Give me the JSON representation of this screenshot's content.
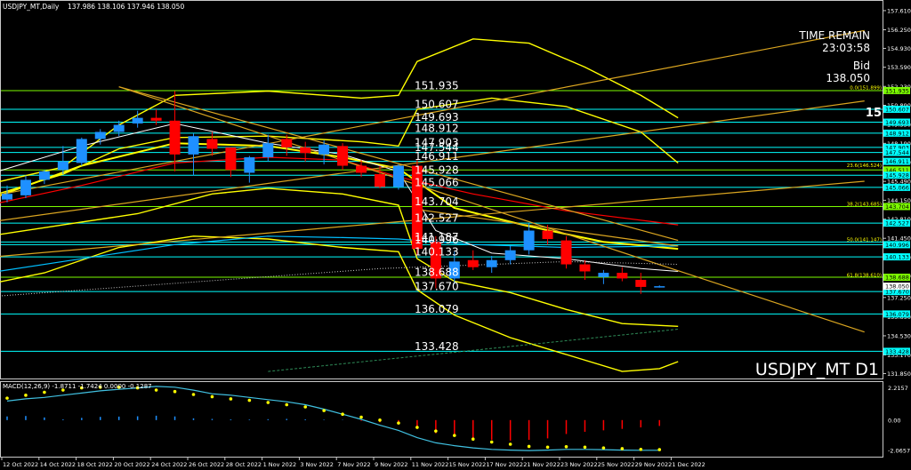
{
  "header": {
    "symbol_timeframe": "USDJPY_MT,Daily",
    "ohlc": "137.986 138.106 137.946 138.050"
  },
  "info_panel": {
    "time_remain_label": "TIME REMAIN",
    "time_remain_value": "23:03:58",
    "bid_label": "Bid",
    "bid_value": "138.050",
    "edge_number": "15"
  },
  "watermark": "USDJPY_MT D1",
  "macd_label": "MACD(12,26,9) -1.8711 -1.7424 0.0000 -0.1287",
  "colors": {
    "background": "#000000",
    "bull_candle": "#1e90ff",
    "bear_candle": "#ff0000",
    "level_line": "#00ffff",
    "green_level": "#7cfc00",
    "envelope": "#ffff00",
    "channel": "#daa520",
    "ma_red": "#ff0000",
    "ma_white": "#ffffff",
    "ma_blue": "#00bfff"
  },
  "price_axis": {
    "ticks": [
      "157.610",
      "156.250",
      "154.930",
      "153.590",
      "152.230",
      "150.890",
      "149.550",
      "148.190",
      "146.850",
      "145.490",
      "144.150",
      "142.810",
      "141.450",
      "140.110",
      "138.770",
      "137.250",
      "135.890",
      "134.530",
      "133.170",
      "131.850"
    ],
    "min": 131.5,
    "max": 158.3
  },
  "macd_axis": {
    "ticks": [
      "2.2157",
      "0.00",
      "-2.0657"
    ],
    "min": -2.5,
    "max": 2.6
  },
  "date_axis": [
    "12 Oct 2022",
    "14 Oct 2022",
    "18 Oct 2022",
    "20 Oct 2022",
    "24 Oct 2022",
    "26 Oct 2022",
    "28 Oct 2022",
    "1 Nov 2022",
    "3 Nov 2022",
    "7 Nov 2022",
    "9 Nov 2022",
    "11 Nov 2022",
    "15 Nov 2022",
    "17 Nov 2022",
    "21 Nov 2022",
    "23 Nov 2022",
    "25 Nov 2022",
    "29 Nov 2022",
    "1 Dec 2022"
  ],
  "levels": [
    {
      "value": 151.935,
      "label": "151.935",
      "badge": "151.935",
      "color": "#7cfc00"
    },
    {
      "value": 150.607,
      "label": "150.607",
      "badge": "150.607",
      "color": "#00ffff"
    },
    {
      "value": 149.693,
      "label": "149.693",
      "badge": "149.693",
      "color": "#00ffff"
    },
    {
      "value": 148.912,
      "label": "148.912",
      "badge": "148.912",
      "color": "#00ffff"
    },
    {
      "value": 147.903,
      "label": "147.903",
      "badge": "147.903",
      "color": "#00ffff"
    },
    {
      "value": 147.544,
      "label": "147.544",
      "badge": "147.544",
      "color": "#00ffff"
    },
    {
      "value": 146.911,
      "label": "146.911",
      "badge": "146.911",
      "color": "#00ffff"
    },
    {
      "value": 146.3,
      "label": "",
      "badge": "146.511",
      "color": "#7cfc00"
    },
    {
      "value": 145.928,
      "label": "145.928",
      "badge": "145.928",
      "color": "#00ffff"
    },
    {
      "value": 145.066,
      "label": "145.066",
      "badge": "145.066",
      "color": "#00ffff"
    },
    {
      "value": 143.704,
      "label": "143.704",
      "badge": "143.704",
      "color": "#7cfc00"
    },
    {
      "value": 142.527,
      "label": "142.527",
      "badge": "142.527",
      "color": "#00ffff"
    },
    {
      "value": 141.187,
      "label": "141.187",
      "badge": "",
      "color": "#00ffff"
    },
    {
      "value": 140.996,
      "label": "140.996",
      "badge": "140.996",
      "color": "#00ffff"
    },
    {
      "value": 140.133,
      "label": "140.133",
      "badge": "140.133",
      "color": "#00ffff"
    },
    {
      "value": 138.688,
      "label": "138.688",
      "badge": "138.688",
      "color": "#7cfc00"
    },
    {
      "value": 137.67,
      "label": "137.670",
      "badge": "137.670",
      "color": "#00ffff"
    },
    {
      "value": 136.079,
      "label": "136.079",
      "badge": "136.079",
      "color": "#00ffff"
    },
    {
      "value": 133.428,
      "label": "133.428",
      "badge": "133.428",
      "color": "#00ffff"
    }
  ],
  "fib_labels": [
    {
      "value": 151.935,
      "text": "0.0(151.899)"
    },
    {
      "value": 146.4,
      "text": "23.6(146.524)"
    },
    {
      "value": 143.685,
      "text": "38.2(143.685)"
    },
    {
      "value": 141.147,
      "text": "50.0(141.147)"
    },
    {
      "value": 138.61,
      "text": "61.8(138.610)"
    }
  ],
  "candles": [
    {
      "o": 144.2,
      "h": 145.2,
      "l": 144.0,
      "c": 144.6
    },
    {
      "o": 144.5,
      "h": 145.9,
      "l": 144.3,
      "c": 145.6
    },
    {
      "o": 145.6,
      "h": 146.3,
      "l": 145.3,
      "c": 146.2
    },
    {
      "o": 146.3,
      "h": 148.0,
      "l": 146.0,
      "c": 146.9
    },
    {
      "o": 146.8,
      "h": 148.6,
      "l": 146.6,
      "c": 148.5
    },
    {
      "o": 148.5,
      "h": 149.2,
      "l": 148.1,
      "c": 149.0
    },
    {
      "o": 149.0,
      "h": 149.8,
      "l": 148.7,
      "c": 149.5
    },
    {
      "o": 149.6,
      "h": 150.5,
      "l": 149.3,
      "c": 150.0
    },
    {
      "o": 150.0,
      "h": 150.6,
      "l": 149.5,
      "c": 149.8
    },
    {
      "o": 149.8,
      "h": 151.9,
      "l": 146.2,
      "c": 147.4
    },
    {
      "o": 147.4,
      "h": 148.9,
      "l": 145.9,
      "c": 148.7
    },
    {
      "o": 148.5,
      "h": 149.0,
      "l": 147.3,
      "c": 147.8
    },
    {
      "o": 147.9,
      "h": 147.9,
      "l": 145.8,
      "c": 146.3
    },
    {
      "o": 146.1,
      "h": 147.3,
      "l": 145.4,
      "c": 147.2
    },
    {
      "o": 147.2,
      "h": 148.8,
      "l": 146.9,
      "c": 148.2
    },
    {
      "o": 148.5,
      "h": 148.8,
      "l": 147.3,
      "c": 147.9
    },
    {
      "o": 147.9,
      "h": 148.3,
      "l": 146.9,
      "c": 147.5
    },
    {
      "o": 147.4,
      "h": 148.4,
      "l": 146.7,
      "c": 148.1
    },
    {
      "o": 148.0,
      "h": 148.2,
      "l": 146.3,
      "c": 146.6
    },
    {
      "o": 146.6,
      "h": 147.0,
      "l": 145.8,
      "c": 146.1
    },
    {
      "o": 146.0,
      "h": 146.6,
      "l": 145.0,
      "c": 145.1
    },
    {
      "o": 145.1,
      "h": 146.7,
      "l": 144.9,
      "c": 146.6
    },
    {
      "o": 146.6,
      "h": 147.0,
      "l": 140.3,
      "c": 140.7
    },
    {
      "o": 141.2,
      "h": 141.6,
      "l": 137.9,
      "c": 138.6
    },
    {
      "o": 138.6,
      "h": 140.5,
      "l": 138.2,
      "c": 139.8
    },
    {
      "o": 139.9,
      "h": 140.6,
      "l": 139.2,
      "c": 139.4
    },
    {
      "o": 139.4,
      "h": 140.2,
      "l": 139.0,
      "c": 139.9
    },
    {
      "o": 139.9,
      "h": 140.9,
      "l": 139.6,
      "c": 140.6
    },
    {
      "o": 140.6,
      "h": 142.5,
      "l": 140.3,
      "c": 142.0
    },
    {
      "o": 142.0,
      "h": 142.4,
      "l": 141.0,
      "c": 141.4
    },
    {
      "o": 141.3,
      "h": 141.6,
      "l": 139.3,
      "c": 139.6
    },
    {
      "o": 139.6,
      "h": 139.9,
      "l": 138.5,
      "c": 139.1
    },
    {
      "o": 138.7,
      "h": 139.2,
      "l": 138.2,
      "c": 139.0
    },
    {
      "o": 139.0,
      "h": 139.4,
      "l": 138.4,
      "c": 138.6
    },
    {
      "o": 138.5,
      "h": 139.0,
      "l": 137.5,
      "c": 138.0
    },
    {
      "o": 137.99,
      "h": 138.11,
      "l": 137.95,
      "c": 138.05
    }
  ],
  "macd_hist": [
    0.25,
    0.28,
    0.18,
    0.05,
    0.15,
    0.22,
    0.24,
    0.26,
    0.3,
    0.25,
    0.12,
    0.08,
    0.05,
    0.04,
    0.06,
    0.08,
    0.05,
    0.03,
    0.02,
    -0.05,
    -0.15,
    -0.3,
    -0.6,
    -0.9,
    -1.1,
    -1.25,
    -1.35,
    -1.4,
    -1.35,
    -1.25,
    -0.95,
    -0.8,
    -0.7,
    -0.6,
    -0.5,
    -0.4
  ],
  "macd_signal": [
    1.5,
    1.7,
    1.9,
    2.05,
    2.2,
    2.25,
    2.25,
    2.2,
    2.05,
    1.95,
    1.75,
    1.6,
    1.45,
    1.35,
    1.2,
    1.05,
    0.9,
    0.65,
    0.4,
    0.2,
    0.0,
    -0.2,
    -0.5,
    -0.75,
    -1.05,
    -1.3,
    -1.5,
    -1.65,
    -1.8,
    -1.85,
    -1.82,
    -1.85,
    -1.9,
    -1.95,
    -2.0,
    -2.02
  ],
  "macd_main": [
    1.3,
    1.45,
    1.55,
    1.7,
    1.85,
    2.0,
    2.1,
    2.2,
    2.3,
    2.25,
    2.05,
    1.8,
    1.7,
    1.55,
    1.4,
    1.25,
    1.05,
    0.75,
    0.4,
    0.05,
    -0.35,
    -0.7,
    -1.2,
    -1.55,
    -1.75,
    -1.9,
    -2.0,
    -2.05,
    -2.08,
    -2.05,
    -2.0,
    -2.0,
    -2.02,
    -2.05,
    -2.06,
    -2.06
  ]
}
